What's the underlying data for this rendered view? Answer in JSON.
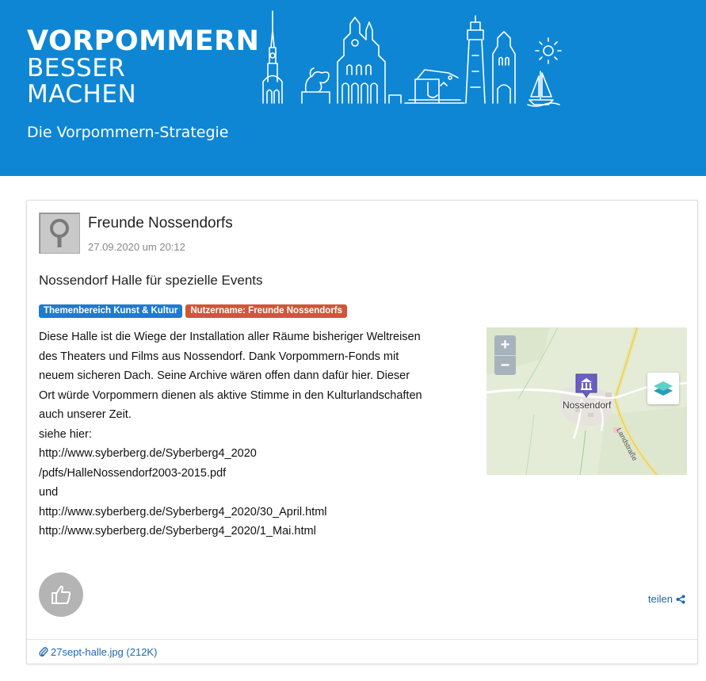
{
  "header": {
    "brand_line1": "VORPOMMERN",
    "brand_line2": "BESSER",
    "brand_line3": "MACHEN",
    "tagline": "Die Vorpommern-Strategie"
  },
  "post": {
    "author": "Freunde Nossendorfs",
    "date": "27.09.2020 um 20:12",
    "title": "Nossendorf Halle für spezielle Events",
    "badges": [
      {
        "label": "Themenbereich Kunst & Kultur",
        "color": "#1d7bd1"
      },
      {
        "label": "Nutzername: Freunde Nossendorfs",
        "color": "#d2553a"
      }
    ],
    "body_lines": [
      "Diese Halle ist die Wiege der Installation aller Räume bisheriger Weltreisen",
      "des Theaters und Films aus Nossendorf. Dank Vorpommern-Fonds mit",
      "neuem sicheren Dach. Seine Archive wären offen dann dafür hier. Dieser",
      "Ort würde Vorpommern dienen als aktive Stimme in den Kulturlandschaften",
      "auch unserer Zeit.",
      "siehe hier:",
      "http://www.syberberg.de/Syberberg4_2020",
      "/pdfs/HalleNossendorf2003-2015.pdf",
      "und",
      "http://www.syberberg.de/Syberberg4_2020/30_April.html",
      "http://www.syberberg.de/Syberberg4_2020/1_Mai.html"
    ],
    "share_label": "teilen",
    "attachment": "27sept-halle.jpg (212K)"
  },
  "map": {
    "zoom_in": "+",
    "zoom_out": "−",
    "place_label": "Nossendorf",
    "road_label": "Landstraße"
  },
  "colors": {
    "banner": "#0e86d4",
    "link": "#1f66ac",
    "pin": "#6a5fc1"
  }
}
